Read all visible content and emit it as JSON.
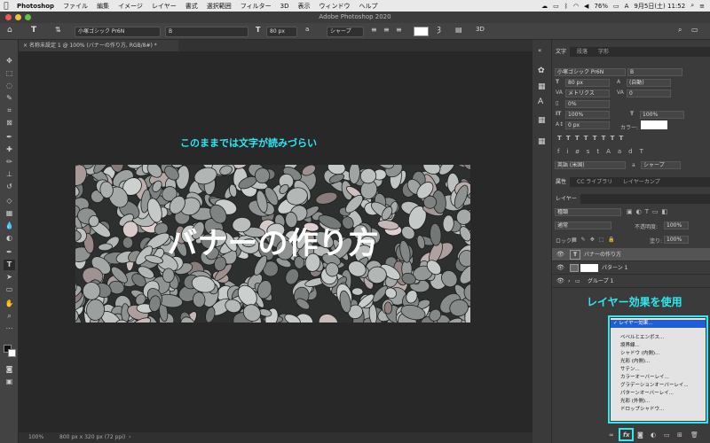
{
  "menubar": {
    "app_name": "Photoshop",
    "items": [
      "ファイル",
      "編集",
      "イメージ",
      "レイヤー",
      "書式",
      "選択範囲",
      "フィルター",
      "3D",
      "表示",
      "ウィンドウ",
      "ヘルプ"
    ],
    "battery": "76%",
    "datetime": "9月5日(土) 11:52"
  },
  "window": {
    "title": "Adobe Photoshop 2020"
  },
  "options_bar": {
    "font_family": "小塚ゴシック Pr6N",
    "font_style": "B",
    "font_size": "80 px",
    "antialias": "シャープ",
    "icon_3d": "3D"
  },
  "document": {
    "tab_label": "名称未設定 1 @ 100% (バナーの作り方, RGB/8#) *",
    "banner_title": "バナーの作り方",
    "annotation_top": "このままでは文字が読みづらい",
    "annotation_right": "レイヤー効果を使用",
    "accent_color": "#2ee8f2"
  },
  "status_bar": {
    "zoom": "100%",
    "doc_size": "800 px x 320 px (72 ppi)"
  },
  "char_panel": {
    "tabs": [
      "文字",
      "段落",
      "字形"
    ],
    "font_family": "小塚ゴシック Pr6N",
    "font_style": "B",
    "font_size": "80 px",
    "leading": "(自動)",
    "kerning": "メトリクス",
    "tracking": "0",
    "tsume": "0%",
    "vscale": "100%",
    "hscale": "100%",
    "baseline": "0 px",
    "color_label": "カラー:",
    "language": "英語 (米国)",
    "aa": "シャープ"
  },
  "props_panel": {
    "tabs": [
      "属性",
      "CC ライブラリ",
      "レイヤーカンプ"
    ]
  },
  "layers_panel": {
    "tab": "レイヤー",
    "filter": "種類",
    "blend_mode": "通常",
    "opacity_label": "不透明度:",
    "opacity": "100%",
    "lock_label": "ロック:",
    "fill_label": "塗り:",
    "fill": "100%",
    "layers": [
      {
        "name": "バナーの作り方",
        "kind": "text"
      },
      {
        "name": "パターン 1",
        "kind": "pattern"
      },
      {
        "name": "グループ 1",
        "kind": "group"
      }
    ]
  },
  "effects_menu": {
    "items": [
      "レイヤー効果...",
      "ベベルとエンボス...",
      "境界線...",
      "シャドウ (内側)...",
      "光彩 (内側)...",
      "サテン...",
      "カラーオーバーレイ...",
      "グラデーションオーバーレイ...",
      "パターンオーバーレイ...",
      "光彩 (外側)...",
      "ドロップシャドウ..."
    ],
    "selected_index": 0
  },
  "fx_button_label": "fx"
}
